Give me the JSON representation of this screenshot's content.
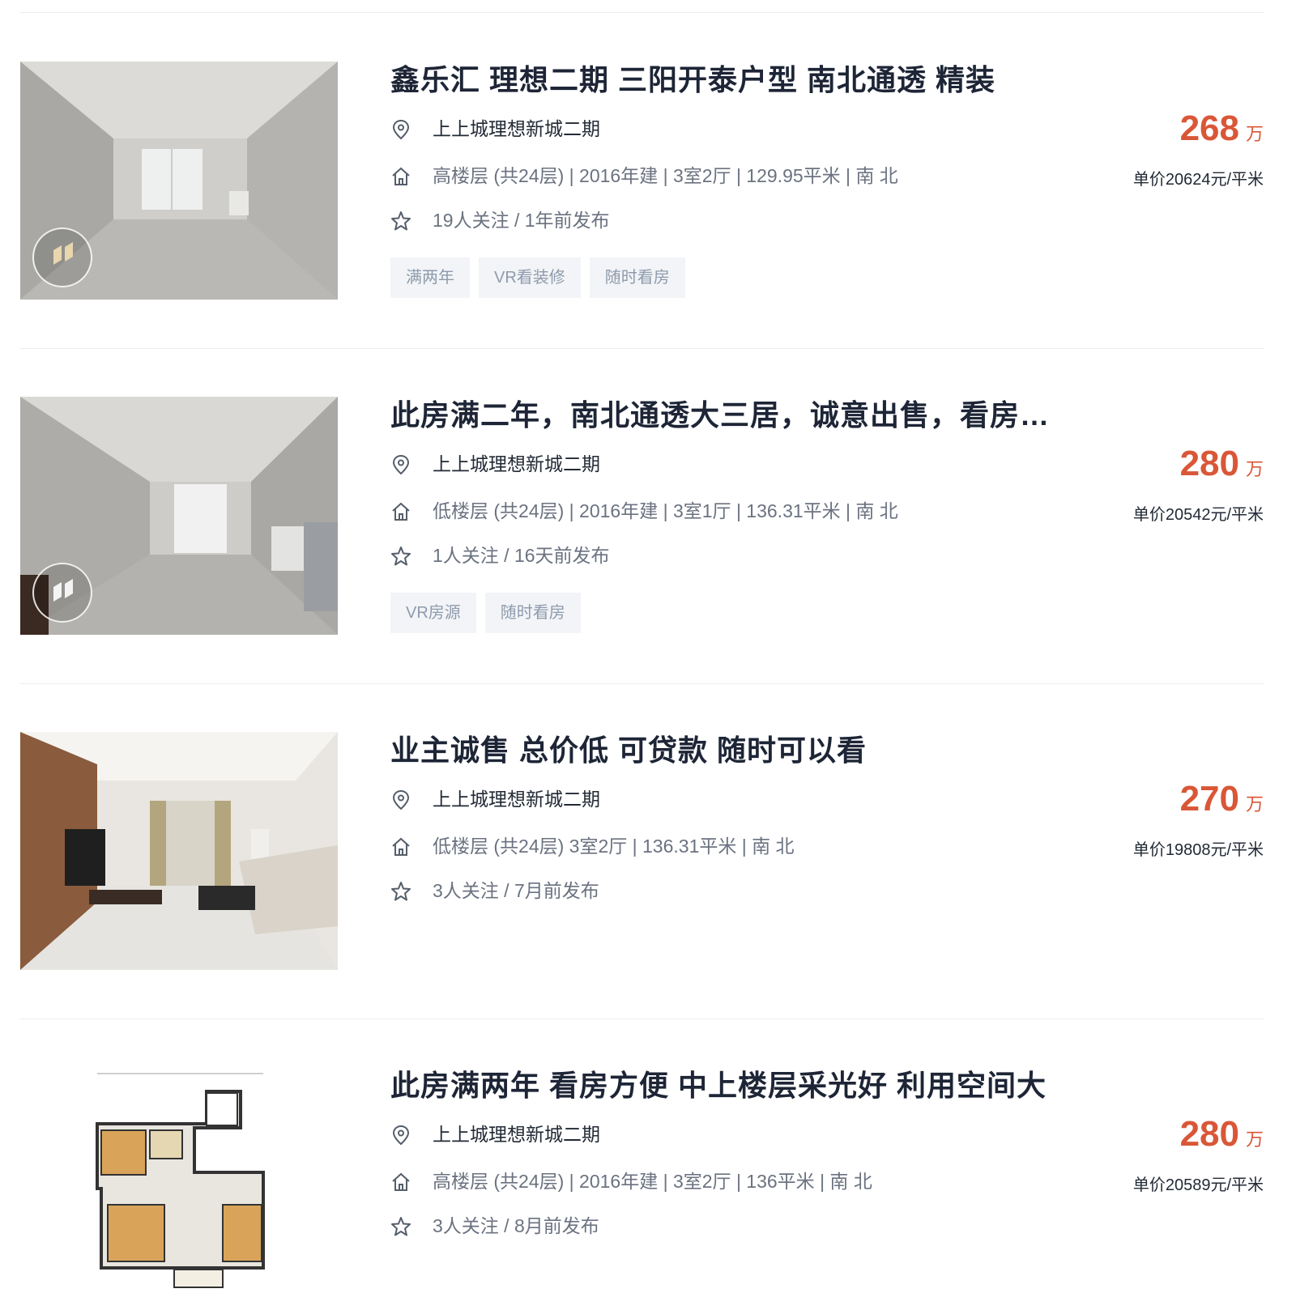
{
  "listings": [
    {
      "title": "鑫乐汇 理想二期 三阳开泰户型 南北通透 精装",
      "community": "上上城理想新城二期",
      "house_info": "高楼层 (共24层) | 2016年建 | 3室2厅 | 129.95平米 | 南 北",
      "follow_info": "19人关注 / 1年前发布",
      "tags": [
        "满两年",
        "VR看装修",
        "随时看房"
      ],
      "price": "268",
      "price_unit": "万",
      "unit_price": "单价20624元/平米"
    },
    {
      "title": "此房满二年，南北通透大三居，诚意出售，看房…",
      "community": "上上城理想新城二期",
      "house_info": "低楼层 (共24层) | 2016年建 | 3室1厅 | 136.31平米 | 南 北",
      "follow_info": "1人关注 / 16天前发布",
      "tags": [
        "VR房源",
        "随时看房"
      ],
      "price": "280",
      "price_unit": "万",
      "unit_price": "单价20542元/平米"
    },
    {
      "title": "业主诚售 总价低 可贷款 随时可以看",
      "community": "上上城理想新城二期",
      "house_info": "低楼层 (共24层) 3室2厅 | 136.31平米 | 南 北",
      "follow_info": "3人关注 / 7月前发布",
      "tags": [],
      "price": "270",
      "price_unit": "万",
      "unit_price": "单价19808元/平米"
    },
    {
      "title": "此房满两年 看房方便 中上楼层采光好 利用空间大",
      "community": "上上城理想新城二期",
      "house_info": "高楼层 (共24层) | 2016年建 | 3室2厅 | 136平米 | 南 北",
      "follow_info": "3人关注 / 8月前发布",
      "tags": [],
      "price": "280",
      "price_unit": "万",
      "unit_price": "单价20589元/平米"
    }
  ],
  "icons": {
    "location": "location-pin-icon",
    "house": "house-icon",
    "star": "star-icon",
    "vr": "vr-badge-icon"
  },
  "colors": {
    "price": "#d95737",
    "title": "#1d2536",
    "tag_bg": "#f2f4f7",
    "tag_text": "#8e9bad"
  }
}
